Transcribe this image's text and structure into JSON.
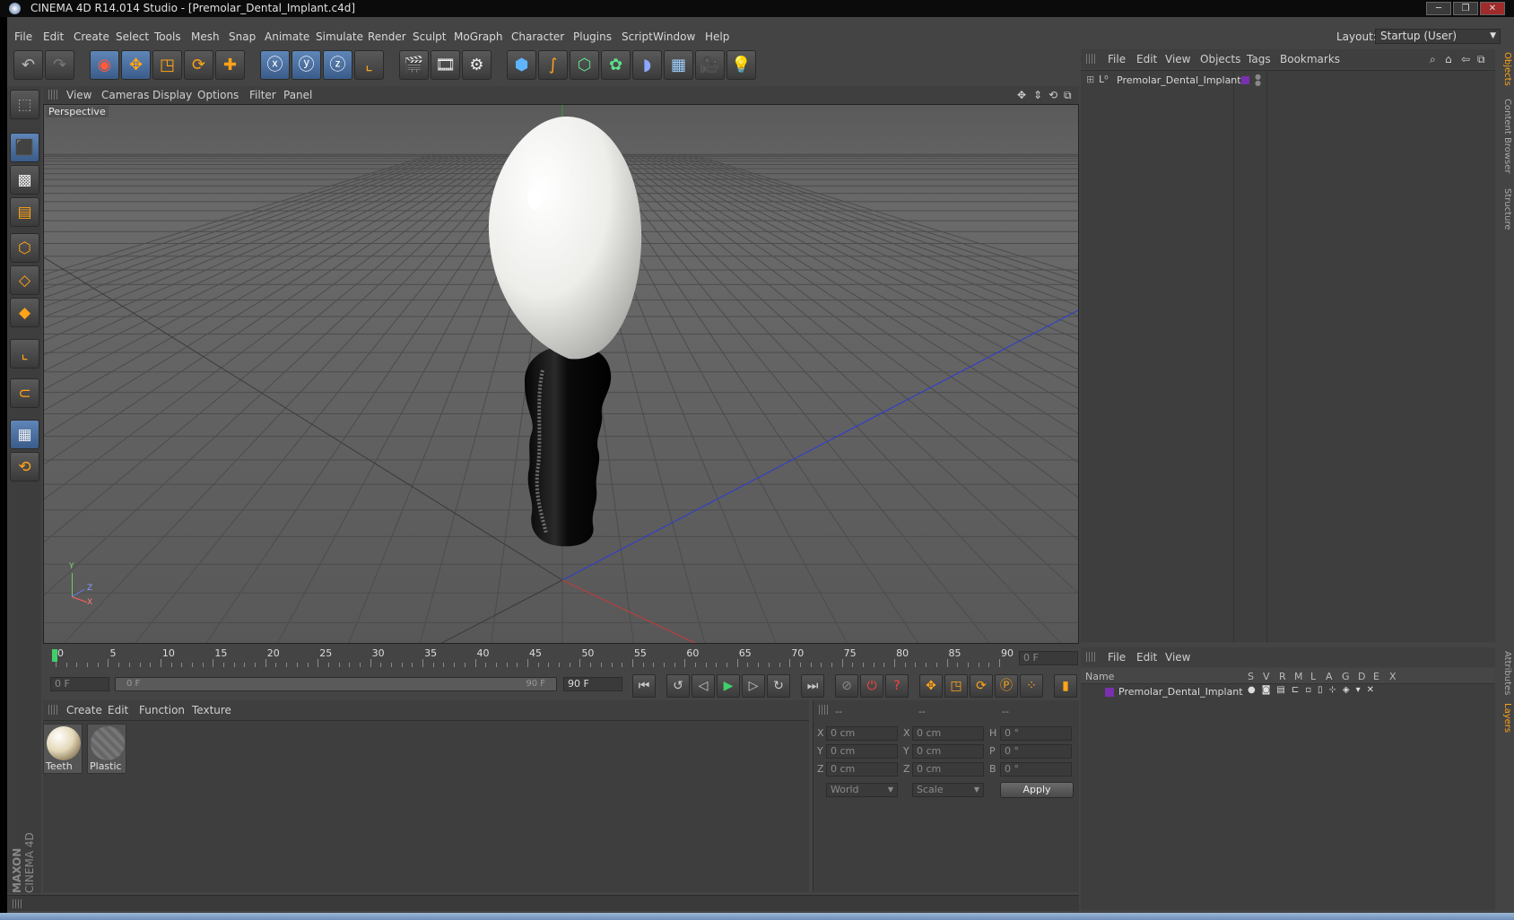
{
  "window": {
    "title": "CINEMA 4D R14.014 Studio - [Premolar_Dental_Implant.c4d]"
  },
  "menu": [
    "File",
    "Edit",
    "Create",
    "Select",
    "Tools",
    "Mesh",
    "Snap",
    "Animate",
    "Simulate",
    "Render",
    "Sculpt",
    "MoGraph",
    "Character",
    "Plugins",
    "Script",
    "Window",
    "Help"
  ],
  "layout": {
    "label": "Layout:",
    "value": "Startup (User)"
  },
  "viewport": {
    "menu": [
      "View",
      "Cameras",
      "Display",
      "Options",
      "Filter",
      "Panel"
    ],
    "label": "Perspective",
    "axis": {
      "y": "Y",
      "z": "Z",
      "x": "X"
    }
  },
  "objects_panel": {
    "menu": [
      "File",
      "Edit",
      "View",
      "Objects",
      "Tags",
      "Bookmarks"
    ],
    "tree_item": "Premolar_Dental_Implant",
    "side_tabs": [
      "Objects",
      "Content Browser",
      "Structure"
    ]
  },
  "layers_panel": {
    "menu": [
      "File",
      "Edit",
      "View"
    ],
    "columns": [
      "Name",
      "S",
      "V",
      "R",
      "M",
      "L",
      "A",
      "G",
      "D",
      "E",
      "X"
    ],
    "row_name": "Premolar_Dental_Implant",
    "side_tabs": [
      "Attributes",
      "Layers"
    ]
  },
  "timeline": {
    "ticks": [
      "0",
      "5",
      "10",
      "15",
      "20",
      "25",
      "30",
      "35",
      "40",
      "45",
      "50",
      "55",
      "60",
      "65",
      "70",
      "75",
      "80",
      "85",
      "90"
    ],
    "current_frame": "0 F",
    "start_frame": "0 F",
    "range_start": "0 F",
    "range_end": "90 F",
    "end_frame": "90 F"
  },
  "material_panel": {
    "menu": [
      "Create",
      "Edit",
      "Function",
      "Texture"
    ],
    "materials": [
      {
        "name": "Teeth"
      },
      {
        "name": "Plastic"
      }
    ]
  },
  "coordinates": {
    "headers": [
      "--",
      "--",
      "--"
    ],
    "rows": [
      {
        "a": "X",
        "av": "0 cm",
        "b": "X",
        "bv": "0 cm",
        "c": "H",
        "cv": "0 °"
      },
      {
        "a": "Y",
        "av": "0 cm",
        "b": "Y",
        "bv": "0 cm",
        "c": "P",
        "cv": "0 °"
      },
      {
        "a": "Z",
        "av": "0 cm",
        "b": "Z",
        "bv": "0 cm",
        "c": "B",
        "cv": "0 °"
      }
    ],
    "space": "World",
    "mode": "Scale",
    "apply": "Apply"
  },
  "brand": {
    "line1": "MAXON",
    "line2": "CINEMA 4D"
  },
  "colors": {
    "accent": "#ffa318",
    "active_blue": "#4a6d9e",
    "layer_purple": "#7a2fb0",
    "axis_blue": "#2b3bd6",
    "axis_red": "#c83a3a"
  }
}
